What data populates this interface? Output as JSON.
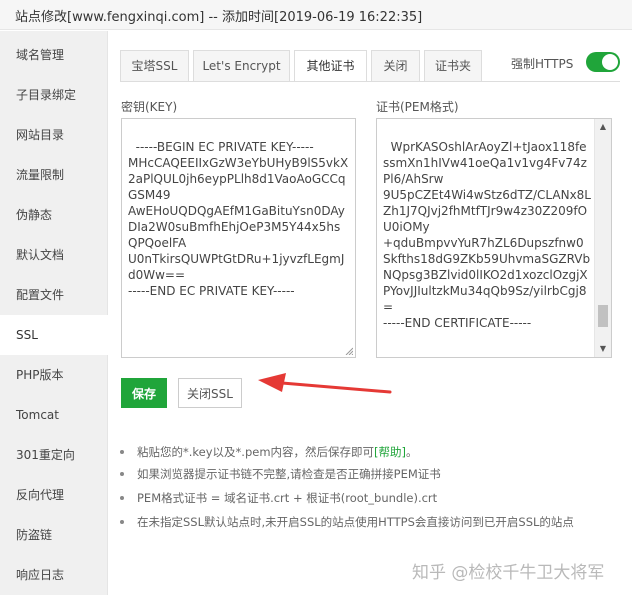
{
  "window": {
    "title": "站点修改[www.fengxinqi.com] -- 添加时间[2019-06-19 16:22:35]"
  },
  "sidebar": {
    "items": [
      {
        "label": "域名管理"
      },
      {
        "label": "子目录绑定"
      },
      {
        "label": "网站目录"
      },
      {
        "label": "流量限制"
      },
      {
        "label": "伪静态"
      },
      {
        "label": "默认文档"
      },
      {
        "label": "配置文件"
      },
      {
        "label": "SSL",
        "active": true
      },
      {
        "label": "PHP版本"
      },
      {
        "label": "Tomcat"
      },
      {
        "label": "301重定向"
      },
      {
        "label": "反向代理"
      },
      {
        "label": "防盗链"
      },
      {
        "label": "响应日志"
      }
    ]
  },
  "tabs": [
    {
      "label": "宝塔SSL"
    },
    {
      "label": "Let's Encrypt"
    },
    {
      "label": "其他证书",
      "active": true
    },
    {
      "label": "关闭"
    },
    {
      "label": "证书夹"
    }
  ],
  "force_https": {
    "label": "强制HTTPS",
    "enabled": true,
    "color": "#20a53a"
  },
  "key_field": {
    "label": "密钥(KEY)",
    "value": "-----BEGIN EC PRIVATE KEY-----\nMHcCAQEEIIxGzW3eYbUHyB9lS5vkX2aPlQUL0jh6eypPLlh8d1VaoAoGCCqGSM49\nAwEHoUQDQgAEfM1GaBituYsn0DAyDIa2W0suBmfhEhjOeP3M5Y44x5hsQPQoelFA\nU0nTkirsQUWPtGtDRu+1jyvzfLEgmJd0Ww==\n-----END EC PRIVATE KEY-----"
  },
  "cert_field": {
    "label": "证书(PEM格式)",
    "value": "WprKASOshlArAoyZl+tJaox118fessmXn1hIVw41oeQa1v1vg4Fv74zPl6/AhSrw\n9U5pCZEt4Wi4wStz6dTZ/CLANx8LZh1J7QJvj2fhMtfTJr9w4z30Z209fOU0iOMy\n+qduBmpvvYuR7hZL6Dupszfnw0Skfths18dG9ZKb59UhvmaSGZRVbNQpsg3BZlvid0lIKO2d1xozclOzgjXPYovJJIultzkMu34qQb9Sz/yilrbCgj8=\n-----END CERTIFICATE-----"
  },
  "buttons": {
    "save": "保存",
    "close_ssl": "关闭SSL",
    "save_color": "#20a53a"
  },
  "tips": {
    "tip1_text": "粘贴您的*.key以及*.pem内容，然后保存即可",
    "tip1_help": "[帮助]",
    "tip1_end": "。",
    "tip2": "如果浏览器提示证书链不完整,请检查是否正确拼接PEM证书",
    "tip3": "PEM格式证书 = 域名证书.crt + 根证书(root_bundle).crt",
    "tip4": "在未指定SSL默认站点时,未开启SSL的站点使用HTTPS会直接访问到已开启SSL的站点"
  },
  "annotation": {
    "arrow_color": "#e53935"
  },
  "watermark": {
    "text": "知乎 @检校千牛卫大将军"
  }
}
